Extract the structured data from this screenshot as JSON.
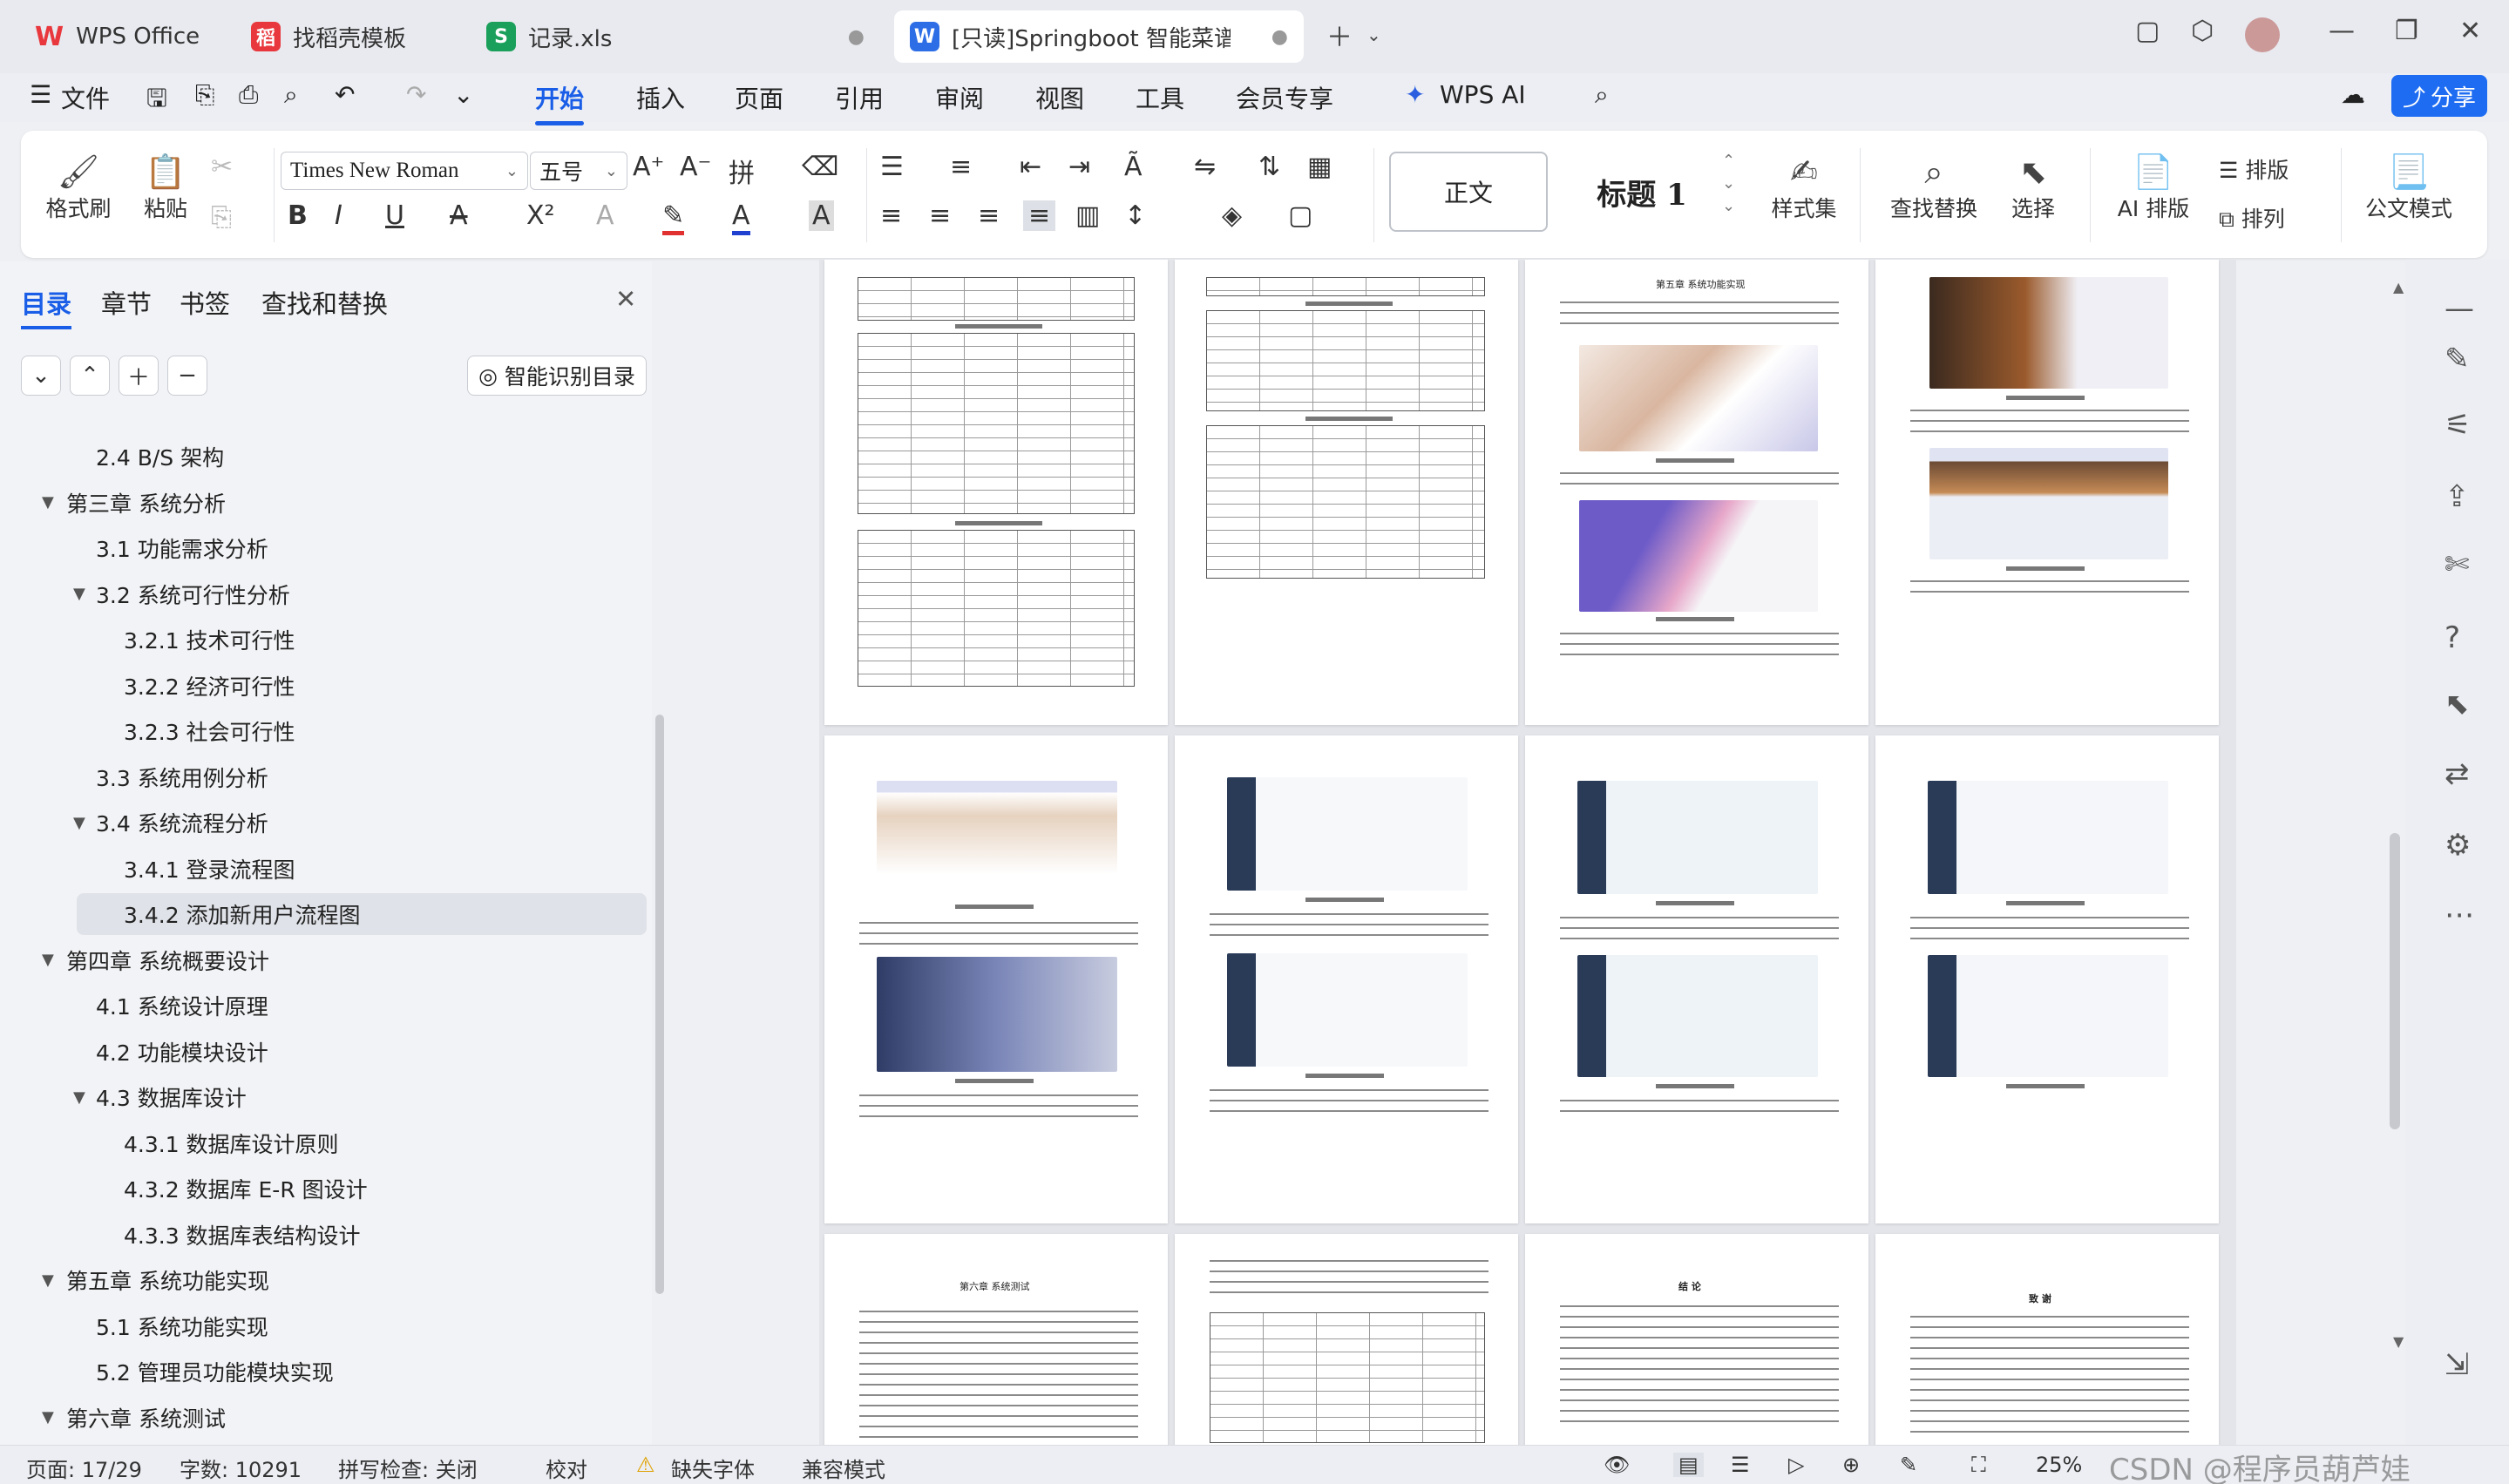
{
  "tabs": [
    {
      "label": "WPS Office",
      "badge": "W",
      "color": "#e8383d"
    },
    {
      "label": "找稻壳模板",
      "badge": "稻",
      "color": "#e8383d"
    },
    {
      "label": "记录.xls",
      "badge": "S",
      "color": "#1aa05a"
    },
    {
      "label": "[只读]Springboot 智能菜谱推",
      "badge": "W",
      "color": "#2d6de6"
    }
  ],
  "menu": {
    "file": "文件",
    "items": [
      "开始",
      "插入",
      "页面",
      "引用",
      "审阅",
      "视图",
      "工具",
      "会员专享"
    ],
    "ai": "WPS AI",
    "share": "分享"
  },
  "ribbon": {
    "format_painter": "格式刷",
    "paste": "粘贴",
    "font": "Times New Roman",
    "size": "五号",
    "style_normal": "正文",
    "style_heading": "标题 1",
    "styles": "样式集",
    "find_replace": "查找替换",
    "select": "选择",
    "ai_layout": "AI 排版",
    "layout": "排版",
    "arrange": "排列",
    "official": "公文模式"
  },
  "nav": {
    "tabs": [
      "目录",
      "章节",
      "书签",
      "查找和替换"
    ],
    "smart_toc": "智能识别目录",
    "items": [
      {
        "text": "2.4 B/S 架构",
        "level": 2,
        "tri": ""
      },
      {
        "text": "第三章  系统分析",
        "level": 1,
        "tri": "▼"
      },
      {
        "text": "3.1 功能需求分析",
        "level": 2,
        "tri": ""
      },
      {
        "text": "3.2 系统可行性分析",
        "level": 2,
        "tri": "▼"
      },
      {
        "text": "3.2.1 技术可行性",
        "level": 3,
        "tri": ""
      },
      {
        "text": "3.2.2  经济可行性",
        "level": 3,
        "tri": ""
      },
      {
        "text": "3.2.3 社会可行性",
        "level": 3,
        "tri": ""
      },
      {
        "text": "3.3  系统用例分析",
        "level": 2,
        "tri": ""
      },
      {
        "text": "3.4 系统流程分析",
        "level": 2,
        "tri": "▼"
      },
      {
        "text": "3.4.1  登录流程图",
        "level": 3,
        "tri": ""
      },
      {
        "text": "3.4.2  添加新用户流程图",
        "level": 3,
        "tri": "",
        "selected": true
      },
      {
        "text": "第四章  系统概要设计",
        "level": 1,
        "tri": "▼"
      },
      {
        "text": "4.1 系统设计原理",
        "level": 2,
        "tri": ""
      },
      {
        "text": "4.2 功能模块设计",
        "level": 2,
        "tri": ""
      },
      {
        "text": "4.3  数据库设计",
        "level": 2,
        "tri": "▼"
      },
      {
        "text": "4.3.1 数据库设计原则",
        "level": 3,
        "tri": ""
      },
      {
        "text": "4.3.2 数据库 E-R 图设计",
        "level": 3,
        "tri": ""
      },
      {
        "text": "4.3.3 数据库表结构设计",
        "level": 3,
        "tri": ""
      },
      {
        "text": "第五章  系统功能实现",
        "level": 1,
        "tri": "▼"
      },
      {
        "text": "5.1 系统功能实现",
        "level": 2,
        "tri": ""
      },
      {
        "text": "5.2 管理员功能模块实现",
        "level": 2,
        "tri": ""
      },
      {
        "text": "第六章  系统测试",
        "level": 1,
        "tri": "▼"
      }
    ]
  },
  "pages": {
    "ch5": "第五章  系统功能实现",
    "ch6": "第六章  系统测试",
    "conclusion": "结    论",
    "thanks": "致    谢"
  },
  "status": {
    "page": "页面: 17/29",
    "words": "字数: 10291",
    "spell": "拼写检查: 关闭",
    "proof": "校对",
    "missing_font": "缺失字体",
    "compat": "兼容模式",
    "zoom": "25%",
    "watermark": "CSDN @程序员葫芦娃"
  }
}
